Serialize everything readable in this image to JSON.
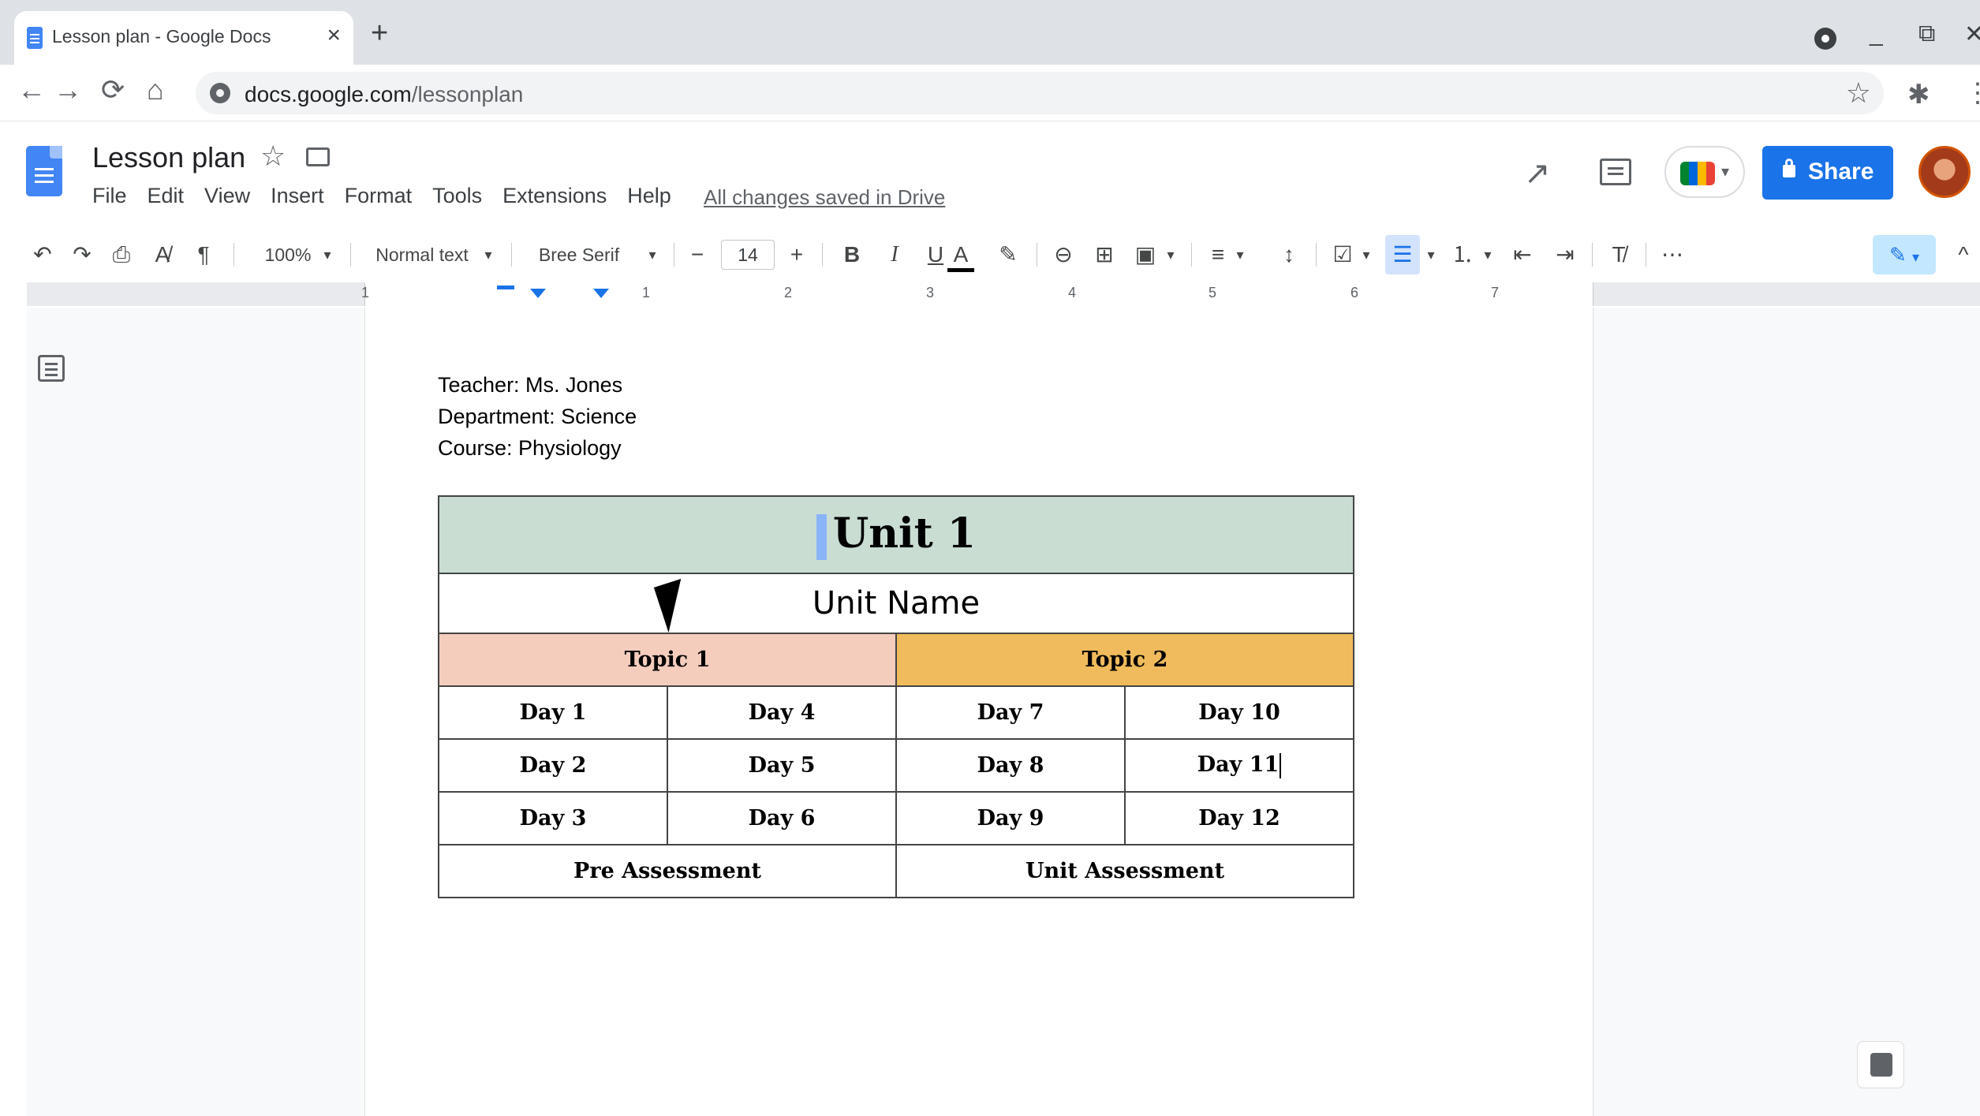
{
  "browser": {
    "tab_title": "Lesson plan - Google Docs",
    "tab_close": "×",
    "new_tab": "+",
    "url_host": "docs.google.com",
    "url_path": "/lessonplan",
    "back": "←",
    "forward": "→",
    "reload": "⟳",
    "home": "⌂",
    "bookmark_star": "☆",
    "extensions": "✱",
    "menu": "⋮",
    "minimize": "_",
    "restore": "⧉",
    "close": "✕"
  },
  "docs": {
    "title": "Lesson plan",
    "star": "☆",
    "menus": [
      "File",
      "Edit",
      "View",
      "Insert",
      "Format",
      "Tools",
      "Extensions",
      "Help"
    ],
    "saved_status": "All changes saved in Drive",
    "trend_icon": "↗",
    "share_label": "Share",
    "meet_caret": "▾"
  },
  "toolbar": {
    "undo": "↶",
    "redo": "↷",
    "print": "⎙",
    "spellcheck": "A̸",
    "paint_format": "¶",
    "zoom": "100%",
    "style": "Normal text",
    "font": "Bree Serif",
    "font_minus": "−",
    "font_size": "14",
    "font_plus": "+",
    "bold": "B",
    "italic": "I",
    "underline": "U",
    "text_color": "A",
    "highlight": "✎",
    "link": "⊖",
    "comment": "⊞",
    "image": "▣",
    "align": "≡",
    "line_spacing": "↕",
    "checklist": "☑",
    "bullets": "☰",
    "numbered": "⒈",
    "indent_less": "⇤",
    "indent_more": "⇥",
    "clear_format": "T̸",
    "more": "⋯",
    "editing_mode": "✎",
    "caret": "▾",
    "collapse": "^"
  },
  "ruler": {
    "numbers": [
      "1",
      "1",
      "2",
      "3",
      "4",
      "5",
      "6",
      "7"
    ]
  },
  "document": {
    "teacher": "Teacher: Ms. Jones",
    "department": "Department: Science",
    "course": "Course: Physiology",
    "table": {
      "unit_title": "Unit 1",
      "unit_name": "Unit Name",
      "topic1": "Topic 1",
      "topic2": "Topic 2",
      "rows": [
        [
          "Day 1",
          "Day 4",
          "Day 7",
          "Day 10"
        ],
        [
          "Day 2",
          "Day 5",
          "Day 8",
          "Day 11"
        ],
        [
          "Day 3",
          "Day 6",
          "Day 9",
          "Day 12"
        ]
      ],
      "pre_assessment": "Pre Assessment",
      "unit_assessment": "Unit Assessment"
    }
  },
  "colors": {
    "unit_header_bg": "#c9ddd3",
    "topic1_bg": "#f4cdbd",
    "topic2_bg": "#f0bb5c",
    "share_button": "#1a73e8",
    "docs_blue": "#4285f4"
  }
}
